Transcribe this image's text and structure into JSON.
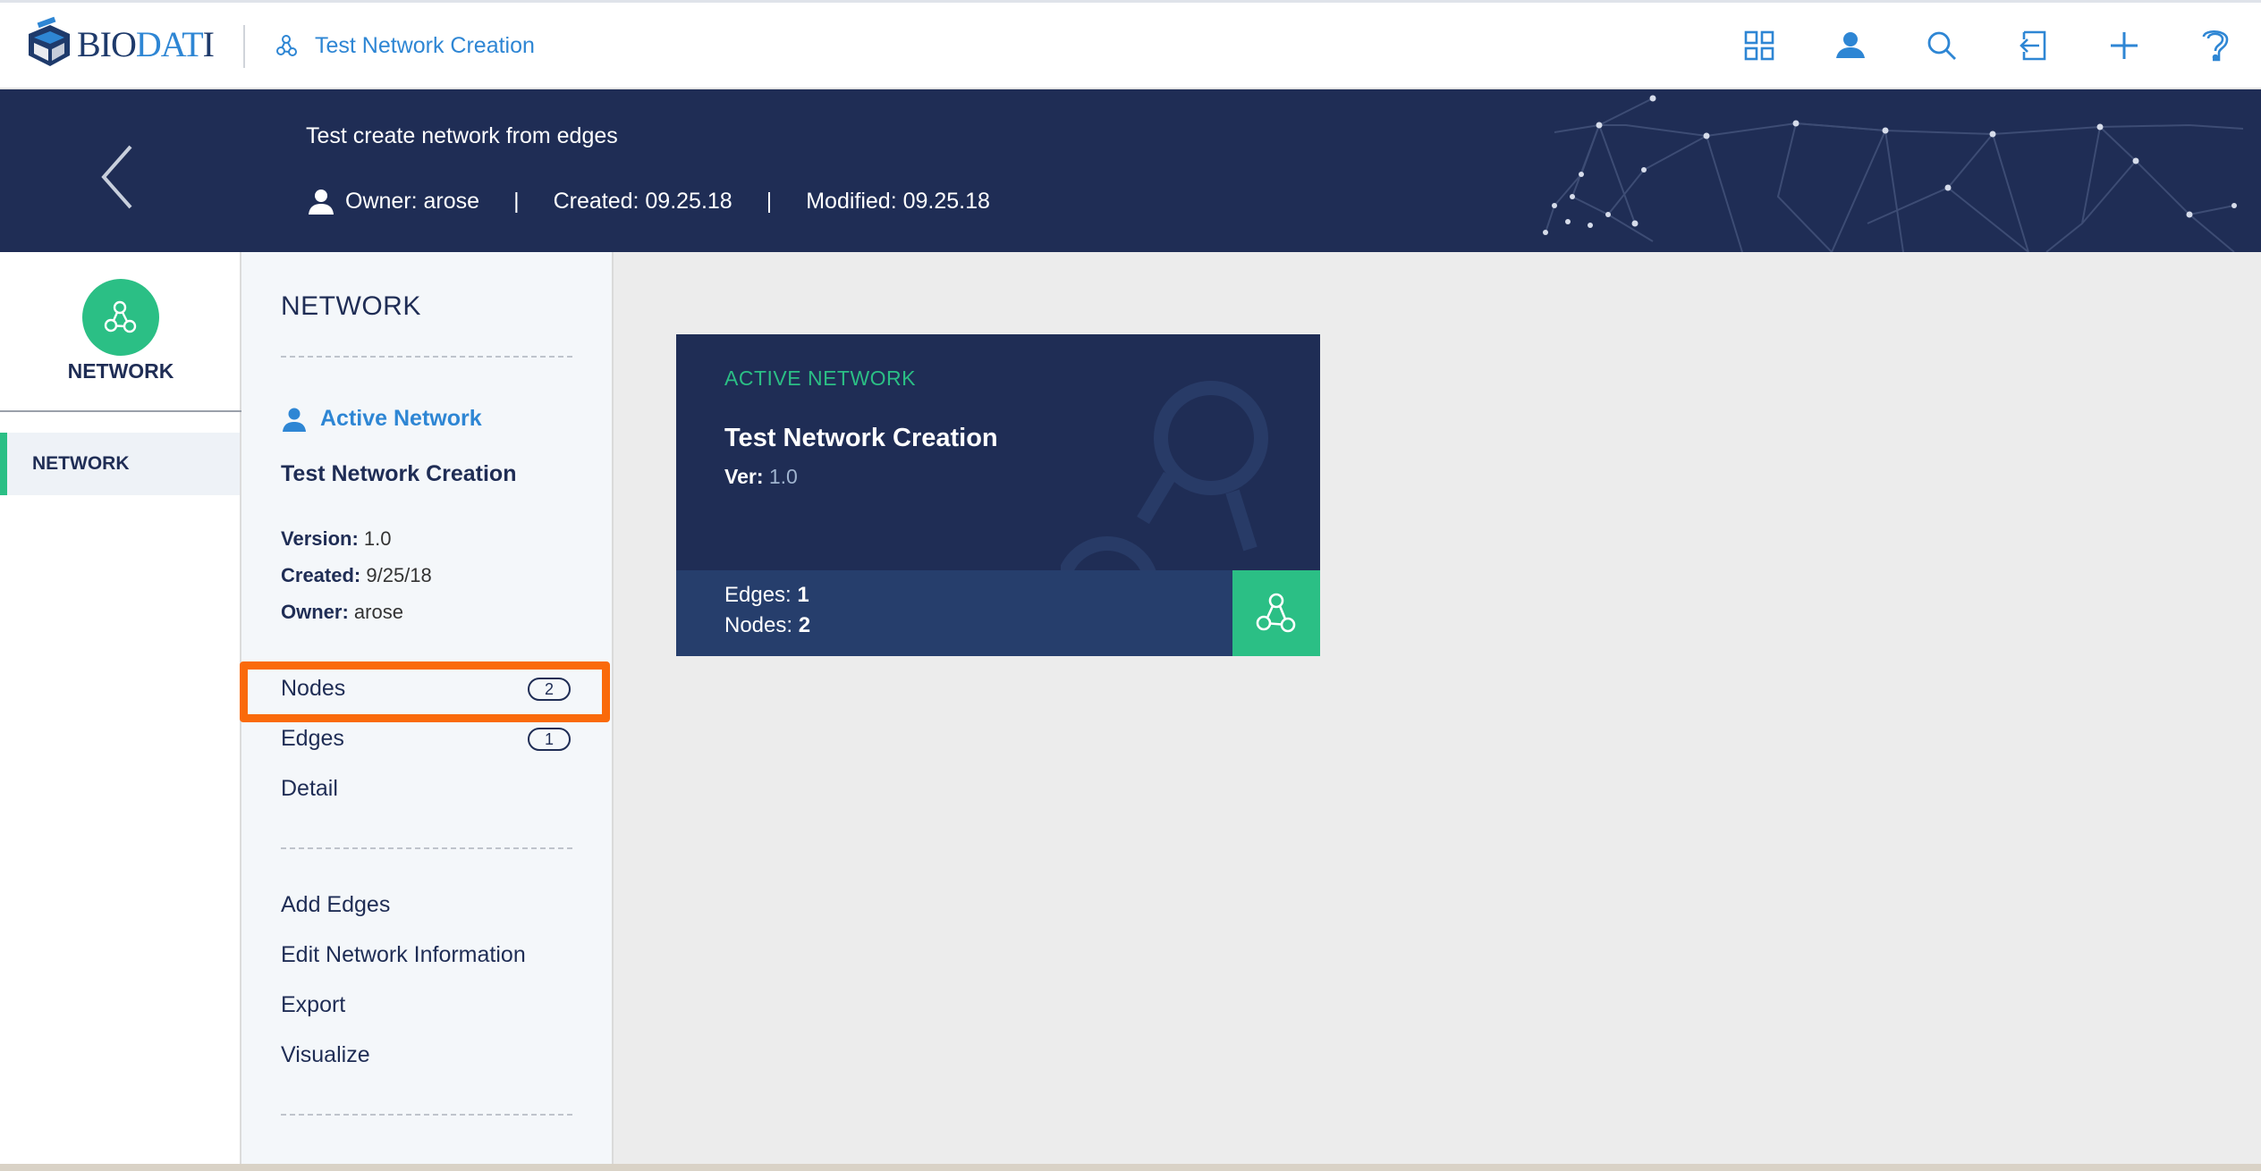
{
  "app": {
    "logo_text_dark_1": "BIO",
    "logo_text_blue": "DAT",
    "logo_text_dark_2": "I",
    "breadcrumb": "Test Network Creation"
  },
  "toolbar": {
    "icons": [
      "grid-icon",
      "user-icon",
      "search-icon",
      "logout-icon",
      "add-icon",
      "help-icon"
    ]
  },
  "header": {
    "title": "Test create network from edges",
    "owner": "Owner: arose",
    "created": "Created: 09.25.18",
    "modified": "Modified: 09.25.18",
    "separator": "|"
  },
  "rail": {
    "section_label": "NETWORK",
    "item_label": "NETWORK"
  },
  "panel": {
    "title": "NETWORK",
    "active_label": "Active Network",
    "network_name": "Test Network Creation",
    "version_label": "Version:",
    "version_value": " 1.0",
    "created_label": "Created:",
    "created_value": " 9/25/18",
    "owner_label": "Owner:",
    "owner_value": " arose",
    "items": [
      {
        "label": "Nodes",
        "count": "2"
      },
      {
        "label": "Edges",
        "count": "1"
      },
      {
        "label": "Detail"
      }
    ],
    "actions": [
      "Add Edges",
      "Edit Network Information",
      "Export",
      "Visualize"
    ]
  },
  "card": {
    "kicker": "ACTIVE NETWORK",
    "name": "Test Network Creation",
    "ver_label": "Ver:",
    "ver_value": " 1.0",
    "edges_label": "Edges: ",
    "edges_value": "1",
    "nodes_label": "Nodes: ",
    "nodes_value": "2"
  },
  "colors": {
    "navy": "#1f2d55",
    "accent_blue": "#2e86d4",
    "accent_green": "#2bbf85",
    "highlight_orange": "#fa6a0a"
  }
}
